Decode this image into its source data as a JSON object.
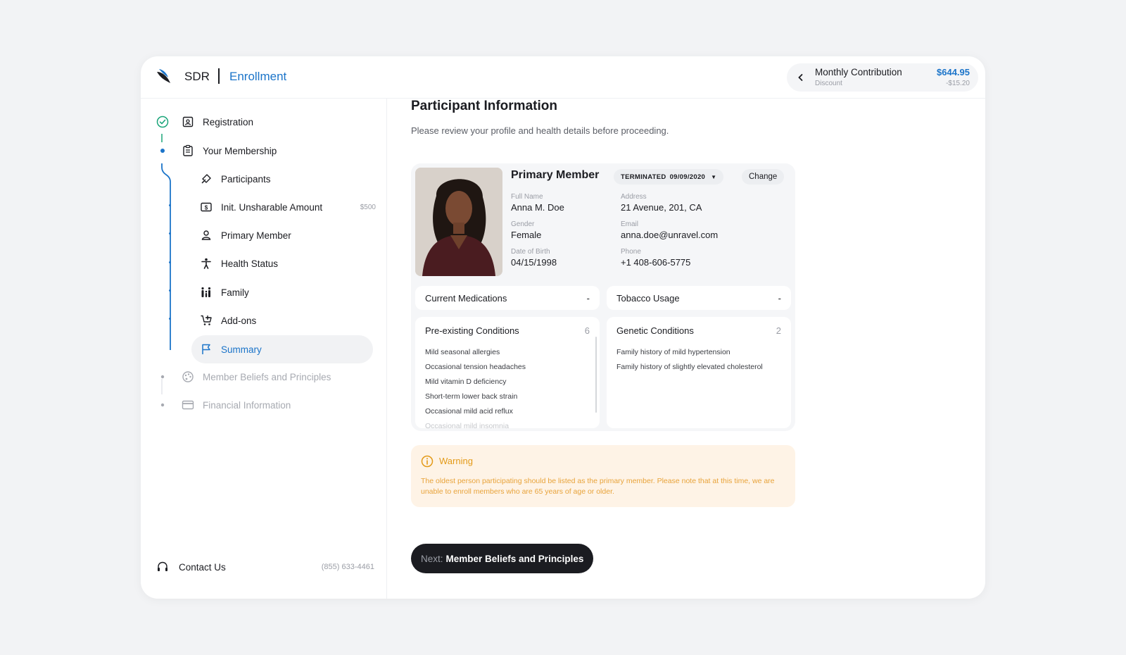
{
  "header": {
    "brand": "SDR",
    "section": "Enrollment",
    "contribution": {
      "title": "Monthly Contribution",
      "subtitle": "Discount",
      "amount": "$644.95",
      "discount": "-$15.20"
    }
  },
  "sidebar": {
    "steps": [
      {
        "label": "Registration",
        "state": "done"
      },
      {
        "label": "Your Membership",
        "state": "current"
      }
    ],
    "substeps": [
      {
        "label": "Participants"
      },
      {
        "label": "Init. Unsharable Amount",
        "badge": "$500"
      },
      {
        "label": "Primary Member"
      },
      {
        "label": "Health Status"
      },
      {
        "label": "Family"
      },
      {
        "label": "Add-ons"
      },
      {
        "label": "Summary",
        "active": true
      }
    ],
    "future_steps": [
      {
        "label": "Member Beliefs and Principles"
      },
      {
        "label": "Financial Information"
      }
    ],
    "contact": {
      "label": "Contact Us",
      "phone": "(855) 633-4461"
    }
  },
  "main": {
    "title": "Participant Information",
    "subtitle": "Please review your profile and health details before proceeding.",
    "member": {
      "heading": "Primary Member",
      "status": "TERMINATED",
      "status_date": "09/09/2020",
      "change_label": "Change",
      "fields": {
        "full_name_label": "Full Name",
        "full_name": "Anna M. Doe",
        "gender_label": "Gender",
        "gender": "Female",
        "dob_label": "Date of Birth",
        "dob": "04/15/1998",
        "address_label": "Address",
        "address": "21 Avenue, 201, CA",
        "email_label": "Email",
        "email": "anna.doe@unravel.com",
        "phone_label": "Phone",
        "phone": "+1 408-606-5775"
      }
    },
    "medications": {
      "label": "Current Medications",
      "value": "-"
    },
    "tobacco": {
      "label": "Tobacco Usage",
      "value": "-"
    },
    "preexisting": {
      "label": "Pre-existing Conditions",
      "count": "6",
      "items": [
        "Mild seasonal allergies",
        "Occasional tension headaches",
        "Mild vitamin D deficiency",
        "Short-term lower back strain",
        "Occasional mild acid reflux",
        "Occasional mild insomnia"
      ]
    },
    "genetic": {
      "label": "Genetic Conditions",
      "count": "2",
      "items": [
        "Family history of mild hypertension",
        "Family history of slightly elevated cholesterol"
      ]
    },
    "warning": {
      "title": "Warning",
      "message": "The oldest person participating should be listed as the primary member. Please note that at this time, we are unable to enroll members who are 65 years of age or older."
    },
    "next": {
      "prefix": "Next:",
      "label": "Member Beliefs and Principles"
    }
  },
  "colors": {
    "accent": "#1b74c9",
    "success": "#1aa579",
    "warning_text": "#e39a18",
    "warning_bg": "#fef3e6",
    "dark_button": "#1b1c21"
  }
}
